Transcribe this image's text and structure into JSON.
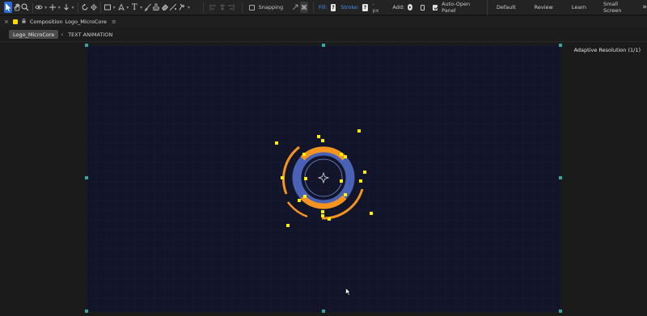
{
  "toolbar": {
    "snapping_label": "Snapping",
    "fill_label": "Fill:",
    "fill_value": "?",
    "stroke_label": "Stroke:",
    "stroke_value": "?",
    "stroke_width": "- px",
    "add_label": "Add:",
    "auto_open_label": "Auto-Open Panel",
    "workspaces": [
      "Default",
      "Review",
      "Learn",
      "Small Screen"
    ],
    "more_glyph": "»"
  },
  "composition": {
    "prefix": "Composition",
    "name": "Logo_MicroCore",
    "menu_glyph": "≡"
  },
  "tabs": {
    "active": "Logo_MicroCore",
    "other": "TEXT ANIMATION"
  },
  "viewer": {
    "resolution": "Adaptive Resolution (1/1)"
  },
  "colors": {
    "accent_blue": "#2d6bd7",
    "logo_orange": "#f5941f",
    "logo_blue": "#4a62b6",
    "handle_yellow": "#fff000",
    "comp_bg": "#12152a"
  },
  "icons": [
    "select-arrow-icon",
    "hand-icon",
    "zoom-icon",
    "orbit-icon",
    "pan-icon",
    "dolly-icon",
    "rotate-icon",
    "anchor-icon",
    "rectangle-icon",
    "pen-icon",
    "type-icon",
    "brush-icon",
    "clone-stamp-icon",
    "eraser-icon",
    "roto-brush-icon",
    "puppet-pin-icon"
  ]
}
